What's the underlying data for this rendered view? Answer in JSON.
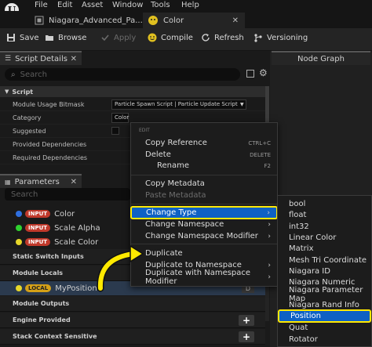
{
  "menubar": {
    "items": [
      "File",
      "Edit",
      "Asset",
      "Window",
      "Tools",
      "Help"
    ]
  },
  "tabs": [
    {
      "label": "Niagara_Advanced_Pa..."
    },
    {
      "label": "Color"
    }
  ],
  "toolbar": {
    "save": "Save",
    "browse": "Browse",
    "apply": "Apply",
    "compile": "Compile",
    "refresh": "Refresh",
    "versioning": "Versioning"
  },
  "script_details": {
    "tab_label": "Script Details",
    "search_placeholder": "Search",
    "category_label": "Script",
    "rows": [
      {
        "label": "Module Usage Bitmask",
        "value": "Particle Spawn Script | Particle Update Script | Pa"
      },
      {
        "label": "Category",
        "value": "Color"
      },
      {
        "label": "Suggested",
        "value": ""
      },
      {
        "label": "Provided Dependencies",
        "value": ""
      },
      {
        "label": "Required Dependencies",
        "value": ""
      }
    ]
  },
  "node_graph": {
    "tab_label": "Node Graph"
  },
  "parameters": {
    "tab_label": "Parameters",
    "search_placeholder": "Search",
    "items": [
      {
        "badge": "INPUT",
        "name": "Color",
        "dot_color": "#2f6fe0"
      },
      {
        "badge": "INPUT",
        "name": "Scale Alpha",
        "dot_color": "#2fd12f"
      },
      {
        "badge": "INPUT",
        "name": "Scale Color",
        "dot_color": "#e6d72a"
      }
    ],
    "sections": {
      "static_switch_inputs": "Static Switch Inputs",
      "module_locals": "Module Locals",
      "module_outputs": "Module Outputs",
      "engine_provided": "Engine Provided",
      "stack_context_sensitive": "Stack Context Sensitive"
    },
    "local_item": {
      "badge": "LOCAL",
      "name": "MyPosition",
      "suffix": "D"
    }
  },
  "context_menu": {
    "section_edit": "EDIT",
    "copy_reference": {
      "label": "Copy Reference",
      "shortcut": "CTRL+C"
    },
    "delete": {
      "label": "Delete",
      "shortcut": "DELETE"
    },
    "rename": {
      "label": "Rename",
      "shortcut": "F2"
    },
    "copy_metadata": "Copy Metadata",
    "paste_metadata": "Paste Metadata",
    "change_type": "Change Type",
    "change_namespace": "Change Namespace",
    "change_namespace_modifier": "Change Namespace Modifier",
    "duplicate": "Duplicate",
    "duplicate_to_namespace": "Duplicate to Namespace",
    "duplicate_with_namespace_modifier": "Duplicate with Namespace Modifier"
  },
  "type_submenu": {
    "items": [
      "bool",
      "float",
      "int32",
      "Linear Color",
      "Matrix",
      "Mesh Tri Coordinate",
      "Niagara ID",
      "Niagara Numeric",
      "Niagara Parameter Map",
      "Niagara Rand Info",
      "Position",
      "Quat",
      "Rotator"
    ],
    "selected": "Position"
  },
  "colors": {
    "highlight": "#0e61c4",
    "annotation": "#ffe900",
    "input_badge": "#c0392b",
    "local_badge": "#d4a017"
  }
}
